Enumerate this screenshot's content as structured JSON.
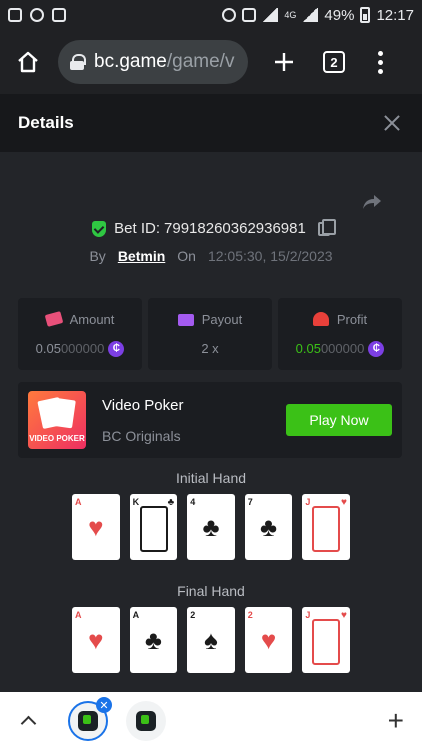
{
  "statusbar": {
    "battery": "49%",
    "time": "12:17",
    "network": "4G"
  },
  "browser": {
    "url_domain": "bc.game",
    "url_path": "/game/v",
    "tab_count": "2"
  },
  "details": {
    "title": "Details"
  },
  "bet": {
    "id_label": "Bet ID:",
    "id_value": "79918260362936981",
    "by_label": "By",
    "user": "Betmin",
    "on_label": "On",
    "datetime": "12:05:30, 15/2/2023"
  },
  "stats": {
    "amount": {
      "label": "Amount",
      "value_main": "0.05",
      "value_faded": "000000"
    },
    "payout": {
      "label": "Payout",
      "value": "2 x"
    },
    "profit": {
      "label": "Profit",
      "value_main": "0.05",
      "value_faded": "000000"
    }
  },
  "game": {
    "thumb_label": "VIDEO POKER",
    "name": "Video Poker",
    "provider": "BC Originals",
    "play_label": "Play Now"
  },
  "initial_hand": {
    "title": "Initial Hand",
    "cards": [
      {
        "rank": "A",
        "suit": "♥",
        "color": "red",
        "face": false
      },
      {
        "rank": "K",
        "suit": "♣",
        "color": "black",
        "face": true
      },
      {
        "rank": "4",
        "suit": "♣",
        "color": "black",
        "face": false
      },
      {
        "rank": "7",
        "suit": "♣",
        "color": "black",
        "face": false
      },
      {
        "rank": "J",
        "suit": "♥",
        "color": "red",
        "face": true
      }
    ]
  },
  "final_hand": {
    "title": "Final Hand",
    "cards": [
      {
        "rank": "A",
        "suit": "♥",
        "color": "red",
        "face": false
      },
      {
        "rank": "A",
        "suit": "♣",
        "color": "black",
        "face": false
      },
      {
        "rank": "2",
        "suit": "♠",
        "color": "black",
        "face": false
      },
      {
        "rank": "2",
        "suit": "♥",
        "color": "red",
        "face": false
      },
      {
        "rank": "J",
        "suit": "♥",
        "color": "red",
        "face": true
      }
    ]
  },
  "coin_symbol": "₵"
}
